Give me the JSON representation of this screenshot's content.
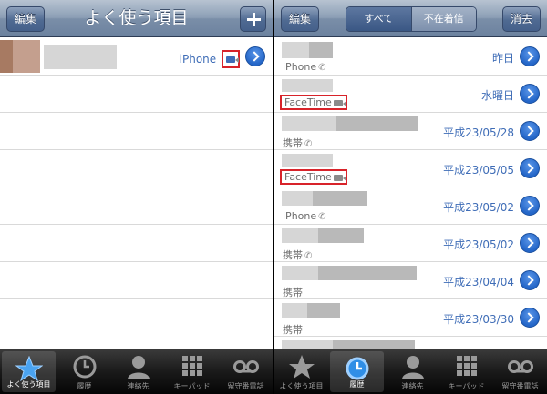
{
  "favorites_screen": {
    "nav": {
      "edit_label": "編集",
      "title": "よく使う項目",
      "add_label": "+"
    },
    "rows": [
      {
        "type_label": "iPhone",
        "icon": "facetime-video-icon"
      }
    ],
    "tabs": [
      {
        "label": "よく使う項目",
        "icon": "star-icon",
        "active": true
      },
      {
        "label": "履歴",
        "icon": "clock-icon",
        "active": false
      },
      {
        "label": "連絡先",
        "icon": "person-icon",
        "active": false
      },
      {
        "label": "キーパッド",
        "icon": "keypad-icon",
        "active": false
      },
      {
        "label": "留守番電話",
        "icon": "voicemail-icon",
        "active": false
      }
    ]
  },
  "recents_screen": {
    "nav": {
      "edit_label": "編集",
      "seg_all": "すべて",
      "seg_missed": "不在着信",
      "clear_label": "消去"
    },
    "rows": [
      {
        "type_label": "iPhone",
        "icon": "phone-icon",
        "date": "昨日"
      },
      {
        "type_label": "FaceTime",
        "icon": "facetime-video-icon",
        "date": "水曜日"
      },
      {
        "type_label": "携帯",
        "icon": "phone-icon",
        "date": "平成23/05/28"
      },
      {
        "type_label": "FaceTime",
        "icon": "facetime-video-icon",
        "date": "平成23/05/05"
      },
      {
        "type_label": "iPhone",
        "icon": "phone-icon",
        "date": "平成23/05/02"
      },
      {
        "type_label": "携帯",
        "icon": "phone-icon",
        "date": "平成23/05/02"
      },
      {
        "type_label": "携帯",
        "icon": "",
        "date": "平成23/04/04"
      },
      {
        "type_label": "携帯",
        "icon": "",
        "date": "平成23/03/30"
      }
    ],
    "tabs": [
      {
        "label": "よく使う項目",
        "icon": "star-icon",
        "active": false
      },
      {
        "label": "履歴",
        "icon": "clock-icon",
        "active": true
      },
      {
        "label": "連絡先",
        "icon": "person-icon",
        "active": false
      },
      {
        "label": "キーパッド",
        "icon": "keypad-icon",
        "active": false
      },
      {
        "label": "留守番電話",
        "icon": "voicemail-icon",
        "active": false
      }
    ]
  },
  "colors": {
    "accent_blue": "#3f6db7",
    "highlight_red": "#d8232a"
  }
}
